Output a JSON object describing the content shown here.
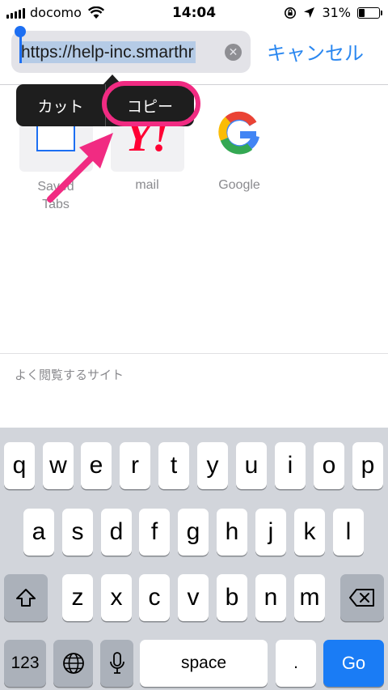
{
  "status_bar": {
    "carrier": "docomo",
    "time": "14:04",
    "battery_percent": "31%",
    "battery_level": 0.31
  },
  "url_bar": {
    "url_text": "https://help-inc.smarthr",
    "clear_icon": "clear-icon",
    "cancel_label": "キャンセル"
  },
  "edit_menu": {
    "cut_label": "カット",
    "copy_label": "コピー"
  },
  "favorites": [
    {
      "label": "Saved\nTabs",
      "icon": "saved-tabs-icon"
    },
    {
      "label": "mail",
      "icon": "yahoo-icon"
    },
    {
      "label": "Google",
      "icon": "google-icon"
    }
  ],
  "yahoo_logo_text": "Y!",
  "frequently_visited_label": "よく閲覧するサイト",
  "keyboard": {
    "row1": [
      "q",
      "w",
      "e",
      "r",
      "t",
      "y",
      "u",
      "i",
      "o",
      "p"
    ],
    "row2": [
      "a",
      "s",
      "d",
      "f",
      "g",
      "h",
      "j",
      "k",
      "l"
    ],
    "row3": [
      "z",
      "x",
      "c",
      "v",
      "b",
      "n",
      "m"
    ],
    "numbers_label": "123",
    "space_label": "space",
    "period_label": ".",
    "go_label": "Go"
  },
  "colors": {
    "accent": "#2a87f0",
    "highlight": "#f12b82",
    "go_key": "#1a7cf5",
    "selection": "#b5cbe6"
  }
}
